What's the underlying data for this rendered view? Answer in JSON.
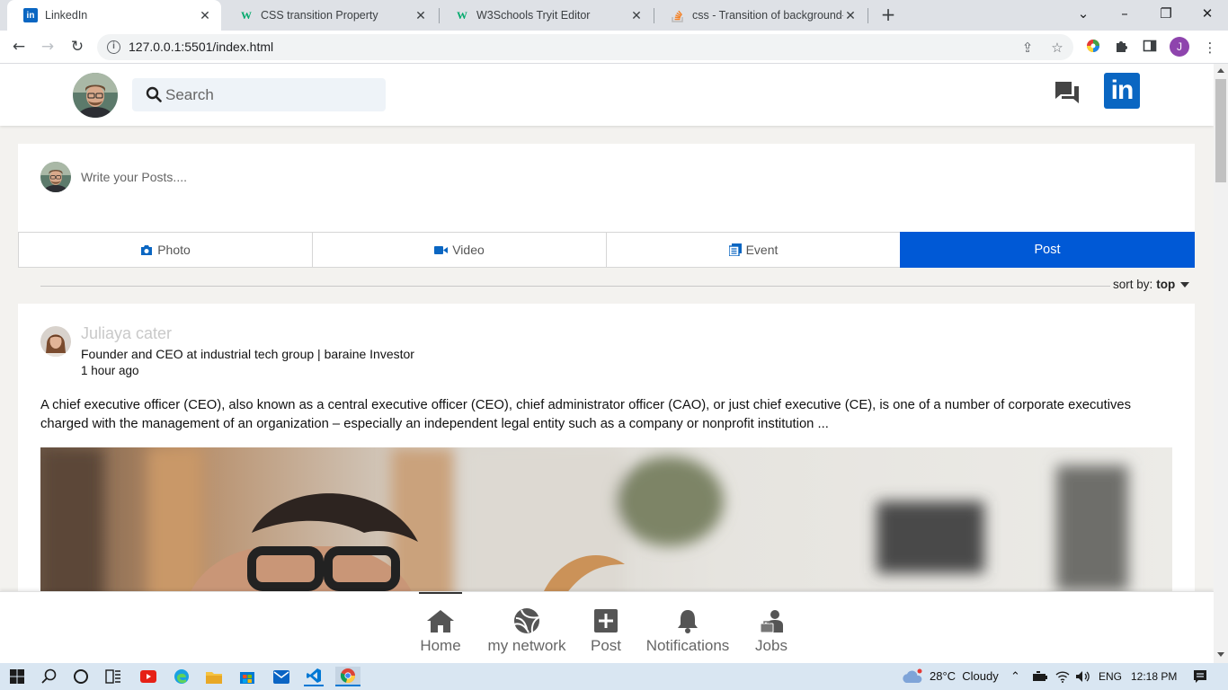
{
  "browser": {
    "tabs": [
      {
        "title": "LinkedIn",
        "favicon": "in",
        "favicon_color": "#0a66c2",
        "active": true
      },
      {
        "title": "CSS transition Property",
        "favicon": "w",
        "favicon_color": "#04aa6d",
        "active": false
      },
      {
        "title": "W3Schools Tryit Editor",
        "favicon": "w",
        "favicon_color": "#04aa6d",
        "active": false
      },
      {
        "title": "css - Transition of background-co",
        "favicon": "stackoverflow",
        "favicon_color": "#f48024",
        "active": false
      }
    ],
    "url": "127.0.0.1:5501/index.html"
  },
  "header": {
    "search_placeholder": "Search",
    "logo_text": "in",
    "brand_color": "#0a66c2"
  },
  "composer": {
    "placeholder": "Write your Posts....",
    "actions": [
      {
        "label": "Photo",
        "icon": "camera-icon"
      },
      {
        "label": "Video",
        "icon": "video-icon"
      },
      {
        "label": "Event",
        "icon": "event-icon"
      },
      {
        "label": "Post",
        "icon": ""
      }
    ],
    "accent": "#0059d6"
  },
  "sort": {
    "label": "sort by:",
    "value": "top"
  },
  "post": {
    "author": "Juliaya cater",
    "headline": "Founder and CEO at industrial tech group | baraine Investor",
    "time": "1 hour ago",
    "text": "A chief executive officer (CEO), also known as a central executive officer (CEO), chief administrator officer (CAO), or just chief executive (CE), is one of a number of corporate executives charged with the management of an organization – especially an independent legal entity such as a company or nonprofit institution ..."
  },
  "bottom_nav": [
    {
      "label": "Home",
      "icon": "home-icon",
      "active": true
    },
    {
      "label": "my network",
      "icon": "network-icon",
      "active": false
    },
    {
      "label": "Post",
      "icon": "plus-square-icon",
      "active": false
    },
    {
      "label": "Notifications",
      "icon": "bell-icon",
      "active": false
    },
    {
      "label": "Jobs",
      "icon": "jobs-icon",
      "active": false
    }
  ],
  "taskbar": {
    "weather": "28°C  Cloudy",
    "language": "ENG",
    "time": "12:18 PM"
  }
}
